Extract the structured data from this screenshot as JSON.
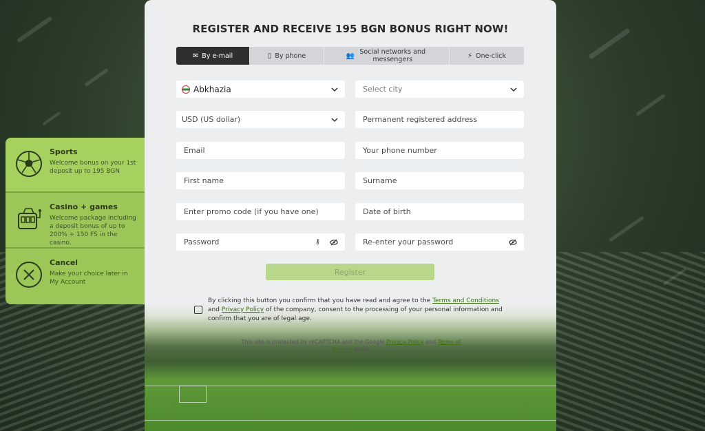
{
  "colors": {
    "accent_green": "#9cc658",
    "tab_active": "#2f2f2f",
    "button_disabled": "#b9d78b",
    "link_green": "#3e6f14"
  },
  "title": "REGISTER AND RECEIVE 195 BGN BONUS RIGHT NOW!",
  "tabs": [
    {
      "label": "By e-mail",
      "icon": "envelope-icon",
      "active": true
    },
    {
      "label": "By phone",
      "icon": "phone-icon",
      "active": false
    },
    {
      "label": "Social networks and messengers",
      "icon": "people-icon",
      "active": false
    },
    {
      "label": "One-click",
      "icon": "lightning-icon",
      "active": false
    }
  ],
  "form": {
    "country": {
      "value": "Abkhazia",
      "icon": "abkhazia-flag-icon"
    },
    "city": {
      "placeholder": "Select city"
    },
    "currency": {
      "value": "USD (US dollar)"
    },
    "address": {
      "placeholder": "Permanent registered address"
    },
    "email": {
      "placeholder": "Email"
    },
    "phone": {
      "placeholder": "Your phone number"
    },
    "first_name": {
      "placeholder": "First name"
    },
    "surname": {
      "placeholder": "Surname"
    },
    "promo": {
      "placeholder": "Enter promo code (if you have one)"
    },
    "dob": {
      "placeholder": "Date of birth"
    },
    "password": {
      "placeholder": "Password"
    },
    "password_repeat": {
      "placeholder": "Re-enter your password"
    },
    "register_label": "Register"
  },
  "consent": {
    "text_1": "By clicking this button you confirm that you have read and agree to the ",
    "terms_link": "Terms and Conditions",
    "text_2": " and ",
    "privacy_link": "Privacy Policy",
    "text_3": " of the company, consent to the processing of your personal information and confirm that you are of legal age."
  },
  "recaptcha": {
    "text_1": "This site is protected by reCAPTCHA and the Google ",
    "privacy_link": "Privacy Policy",
    "text_2": " and ",
    "terms_link": "Terms of Service",
    "text_3": " apply."
  },
  "side_panel": [
    {
      "title": "Sports",
      "desc": "Welcome bonus on your 1st deposit up to 195 BGN",
      "icon": "soccer-ball-icon"
    },
    {
      "title": "Casino + games",
      "desc": "Welcome package including a deposit bonus of up to 200% + 150 FS in the casino.",
      "icon": "slot-machine-icon"
    },
    {
      "title": "Cancel",
      "desc": "Make your choice later in My Account",
      "icon": "close-circle-icon"
    }
  ]
}
